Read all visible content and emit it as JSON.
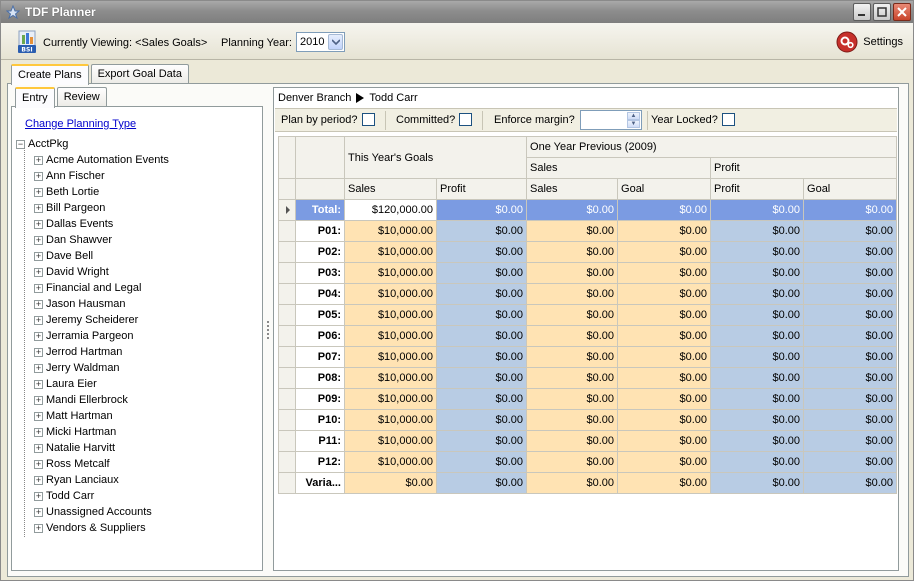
{
  "window": {
    "title": "TDF Planner"
  },
  "toolbar": {
    "viewing_label": "Currently Viewing:",
    "viewing_value": "<Sales Goals>",
    "planning_year_label": "Planning Year:",
    "planning_year_value": "2010",
    "settings_label": "Settings",
    "logo_text": "BSI"
  },
  "outer_tabs": [
    "Create Plans",
    "Export Goal Data"
  ],
  "left_tabs": [
    "Entry",
    "Review"
  ],
  "left": {
    "change_link": "Change Planning Type",
    "root": "AcctPkg",
    "items": [
      "Acme Automation Events",
      "Ann Fischer",
      "Beth Lortie",
      "Bill Pargeon",
      "Dallas Events",
      "Dan Shawver",
      "Dave Bell",
      "David Wright",
      "Financial and Legal",
      "Jason Hausman",
      "Jeremy Scheiderer",
      "Jerramia Pargeon",
      "Jerrod Hartman",
      "Jerry Waldman",
      "Laura Eier",
      "Mandi Ellerbrock",
      "Matt Hartman",
      "Micki Hartman",
      "Natalie Harvitt",
      "Ross Metcalf",
      "Ryan Lanciaux",
      "Todd Carr",
      "Unassigned Accounts",
      "Vendors & Suppliers"
    ]
  },
  "breadcrumb": {
    "branch": "Denver Branch",
    "person": "Todd Carr"
  },
  "options": {
    "plan_by_period": "Plan by period?",
    "committed": "Committed?",
    "enforce_margin": "Enforce margin?",
    "year_locked": "Year Locked?"
  },
  "grid": {
    "group_this_year": "This Year's Goals",
    "group_prev_year": "One Year Previous (2009)",
    "sub_sales": "Sales",
    "sub_profit": "Profit",
    "columns": [
      "Sales",
      "Profit",
      "Sales",
      "Goal",
      "Profit",
      "Goal"
    ],
    "rows": [
      {
        "label": "Total:",
        "values": [
          "$120,000.00",
          "$0.00",
          "$0.00",
          "$0.00",
          "$0.00",
          "$0.00"
        ]
      },
      {
        "label": "P01:",
        "values": [
          "$10,000.00",
          "$0.00",
          "$0.00",
          "$0.00",
          "$0.00",
          "$0.00"
        ]
      },
      {
        "label": "P02:",
        "values": [
          "$10,000.00",
          "$0.00",
          "$0.00",
          "$0.00",
          "$0.00",
          "$0.00"
        ]
      },
      {
        "label": "P03:",
        "values": [
          "$10,000.00",
          "$0.00",
          "$0.00",
          "$0.00",
          "$0.00",
          "$0.00"
        ]
      },
      {
        "label": "P04:",
        "values": [
          "$10,000.00",
          "$0.00",
          "$0.00",
          "$0.00",
          "$0.00",
          "$0.00"
        ]
      },
      {
        "label": "P05:",
        "values": [
          "$10,000.00",
          "$0.00",
          "$0.00",
          "$0.00",
          "$0.00",
          "$0.00"
        ]
      },
      {
        "label": "P06:",
        "values": [
          "$10,000.00",
          "$0.00",
          "$0.00",
          "$0.00",
          "$0.00",
          "$0.00"
        ]
      },
      {
        "label": "P07:",
        "values": [
          "$10,000.00",
          "$0.00",
          "$0.00",
          "$0.00",
          "$0.00",
          "$0.00"
        ]
      },
      {
        "label": "P08:",
        "values": [
          "$10,000.00",
          "$0.00",
          "$0.00",
          "$0.00",
          "$0.00",
          "$0.00"
        ]
      },
      {
        "label": "P09:",
        "values": [
          "$10,000.00",
          "$0.00",
          "$0.00",
          "$0.00",
          "$0.00",
          "$0.00"
        ]
      },
      {
        "label": "P10:",
        "values": [
          "$10,000.00",
          "$0.00",
          "$0.00",
          "$0.00",
          "$0.00",
          "$0.00"
        ]
      },
      {
        "label": "P11:",
        "values": [
          "$10,000.00",
          "$0.00",
          "$0.00",
          "$0.00",
          "$0.00",
          "$0.00"
        ]
      },
      {
        "label": "P12:",
        "values": [
          "$10,000.00",
          "$0.00",
          "$0.00",
          "$0.00",
          "$0.00",
          "$0.00"
        ]
      },
      {
        "label": "Varia...",
        "values": [
          "$0.00",
          "$0.00",
          "$0.00",
          "$0.00",
          "$0.00",
          "$0.00"
        ]
      }
    ]
  },
  "colors": {
    "sales_cell": "#ffe3b3",
    "blue_cell": "#b8cce4",
    "selected_row": "#7b9be2"
  }
}
